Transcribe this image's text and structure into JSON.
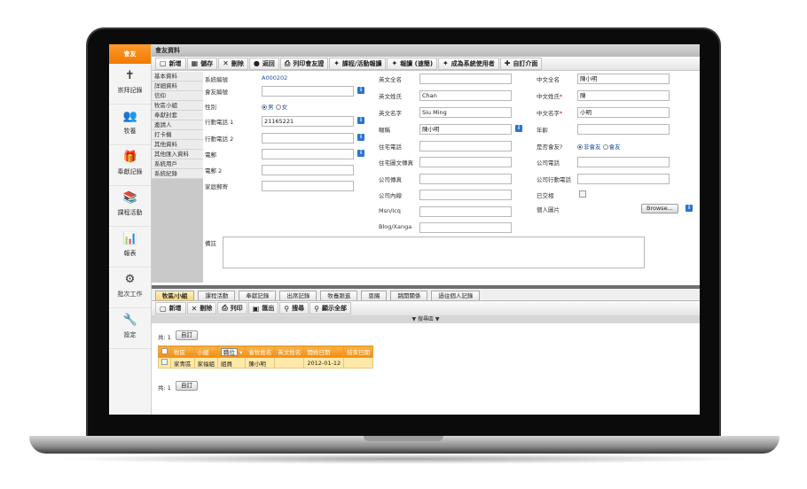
{
  "app": {
    "header_label": "會友",
    "window_title": "會友資料"
  },
  "sidebar": [
    {
      "label": "崇拜記錄",
      "icon": "worship-icon",
      "glyph": "✝"
    },
    {
      "label": "牧養",
      "icon": "people-icon",
      "glyph": "👥"
    },
    {
      "label": "奉獻記錄",
      "icon": "offering-icon",
      "glyph": "🎁"
    },
    {
      "label": "課程活動",
      "icon": "course-icon",
      "glyph": "📚"
    },
    {
      "label": "報表",
      "icon": "report-icon",
      "glyph": "📊"
    },
    {
      "label": "批次工作",
      "icon": "batch-icon",
      "glyph": "⚙"
    },
    {
      "label": "設定",
      "icon": "settings-icon",
      "glyph": "🔧"
    }
  ],
  "toolbar": [
    {
      "label": "新增",
      "glyph": "▢",
      "icon": "new-icon"
    },
    {
      "label": "儲存",
      "glyph": "▦",
      "icon": "save-icon"
    },
    {
      "label": "刪除",
      "glyph": "✕",
      "icon": "delete-icon"
    },
    {
      "label": "返回",
      "glyph": "●",
      "icon": "back-icon"
    },
    {
      "label": "列印會友證",
      "glyph": "⎙",
      "icon": "print-icon"
    },
    {
      "label": "課程/活動報讀",
      "glyph": "✦",
      "icon": "enroll-icon"
    },
    {
      "label": "報讀 (速簡)",
      "glyph": "✦",
      "icon": "quick-enroll-icon"
    },
    {
      "label": "成為系統使用者",
      "glyph": "✦",
      "icon": "user-icon"
    },
    {
      "label": "自訂介面",
      "glyph": "✚",
      "icon": "customize-icon"
    }
  ],
  "nav": [
    "基本資料",
    "詳細資料",
    "信仰",
    "牧區小組",
    "奉獻封套",
    "邀請人",
    "打卡機",
    "其他資料",
    "其他匯入資料",
    "系統用戶",
    "系統紀錄"
  ],
  "form": {
    "system_id_label": "系統編號",
    "system_id": "A000202",
    "member_id_label": "會友編號",
    "gender_label": "性別",
    "gender_male": "男",
    "gender_female": "女",
    "mobile1_label": "行動電話 1",
    "mobile1": "21165221",
    "mobile2_label": "行動電話 2",
    "email_label": "電郵",
    "email2_label": "電郵 2",
    "home_mail_label": "家庭郵寄",
    "eng_full_label": "英文全名",
    "eng_last_label": "英文姓氏",
    "eng_last": "Chan",
    "eng_first_label": "英文名字",
    "eng_first": "Siu Ming",
    "nickname_label": "暱稱",
    "nickname": "陳小明",
    "home_phone_label": "住宅電話",
    "home_fax_label": "住宅圖文傳真",
    "company_fax_label": "公司傳真",
    "company_ext_label": "公司內線",
    "msn_label": "Msn/Icq",
    "blog_label": "Blog/Xanga",
    "chn_full_label": "中文全名",
    "chn_full": "陳小明",
    "chn_last_label": "中文姓氏",
    "chn_last": "陳",
    "chn_first_label": "中文名字",
    "chn_first": "小明",
    "age_label": "年齡",
    "is_member_label": "是否會友?",
    "non_member": "非會友",
    "member": "會友",
    "company_phone_label": "公司電話",
    "company_mobile_label": "公司行動電話",
    "married_label": "已交相",
    "photo_label": "個人圖片",
    "browse_button": "Browse...",
    "remarks_label": "備註",
    "required_mark": "*",
    "info_glyph": "i"
  },
  "tabs": [
    "牧區/小組",
    "課程活動",
    "奉獻記錄",
    "出席記錄",
    "牧養跟進",
    "恩賜",
    "跳開關係",
    "過往個人記錄"
  ],
  "toolbar2": [
    {
      "label": "新增",
      "glyph": "▢",
      "icon": "new-icon"
    },
    {
      "label": "刪除",
      "glyph": "✕",
      "icon": "delete-icon"
    },
    {
      "label": "列印",
      "glyph": "⎙",
      "icon": "print-icon"
    },
    {
      "label": "匯出",
      "glyph": "▣",
      "icon": "export-icon"
    },
    {
      "label": "搜尋",
      "glyph": "⚲",
      "icon": "search-icon"
    },
    {
      "label": "顯示全部",
      "glyph": "⚲",
      "icon": "show-all-icon"
    }
  ],
  "search_bar": "▼ 搜尋區 ▼",
  "count_top": "共: 1",
  "custom_button_top": "自訂",
  "count_bottom": "共: 1",
  "custom_button_bottom": "自訂",
  "grid": {
    "headers": [
      "牧區",
      "小組",
      "職位",
      "會牧姓名",
      "英文姓名",
      "開始日期",
      "結束日期"
    ],
    "sort_label": "職位",
    "rows": [
      [
        "家青區",
        "家福組",
        "組員",
        "陳小明",
        "",
        "2012-01-12",
        ""
      ]
    ]
  }
}
